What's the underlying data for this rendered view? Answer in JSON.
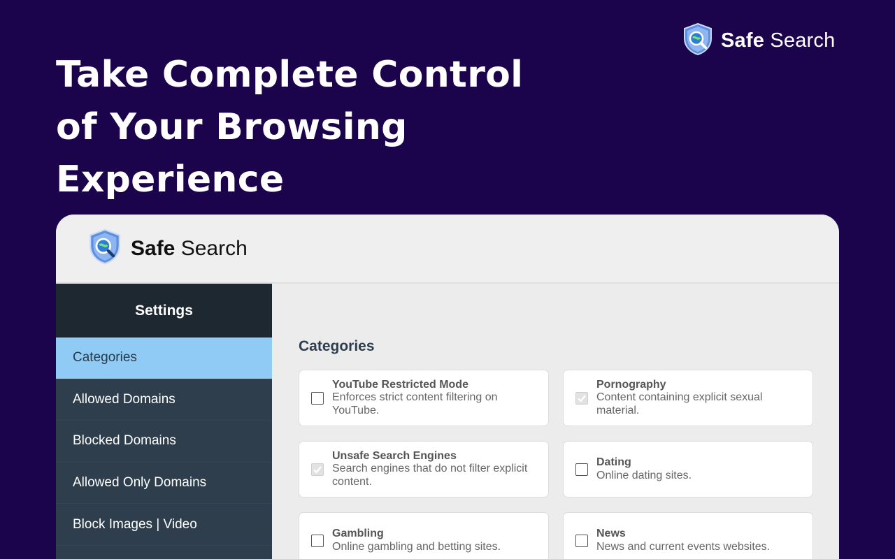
{
  "promo": {
    "brand_bold": "Safe",
    "brand_light": " Search",
    "headline_lines": [
      "Take Complete Control",
      "of Your Browsing",
      "Experience"
    ]
  },
  "app": {
    "brand_bold": "Safe",
    "brand_light": " Search",
    "sidebar": {
      "title": "Settings",
      "items": [
        {
          "label": "Categories",
          "active": true
        },
        {
          "label": "Allowed Domains",
          "active": false
        },
        {
          "label": "Blocked Domains",
          "active": false
        },
        {
          "label": "Allowed Only Domains",
          "active": false
        },
        {
          "label": "Block Images | Video",
          "active": false
        }
      ]
    },
    "main": {
      "section_title": "Categories",
      "categories": [
        {
          "title": "YouTube Restricted Mode",
          "desc": [
            "Enforces strict content filtering on",
            "YouTube."
          ],
          "checked": false,
          "disabled": false
        },
        {
          "title": "Pornography",
          "desc": [
            "Content containing explicit sexual",
            "material."
          ],
          "checked": true,
          "disabled": true
        },
        {
          "title": "Unsafe Search Engines",
          "desc": [
            "Search engines that do not filter explicit",
            "content."
          ],
          "checked": true,
          "disabled": true
        },
        {
          "title": "Dating",
          "desc": [
            "Online dating sites."
          ],
          "checked": false,
          "disabled": false
        },
        {
          "title": "Gambling",
          "desc": [
            "Online gambling and betting sites."
          ],
          "checked": false,
          "disabled": false
        },
        {
          "title": "News",
          "desc": [
            "News and current events websites."
          ],
          "checked": false,
          "disabled": false
        }
      ]
    }
  },
  "colors": {
    "background": "#1c044c",
    "sidebar": "#2e3e4d",
    "sidebar_header": "#1e2830",
    "active_item": "#8fcbf5",
    "content_bg": "#ececec"
  },
  "icons": {
    "logo": "shield-magnifier-logo",
    "checkbox_checked": "check-icon"
  }
}
